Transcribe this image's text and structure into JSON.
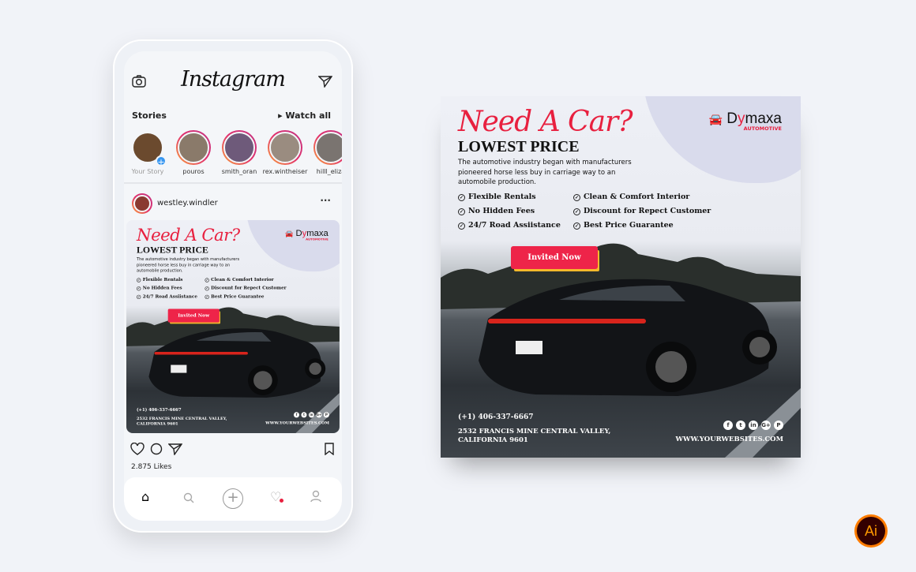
{
  "instagram": {
    "app_title": "Instagram",
    "stories_label": "Stories",
    "watch_all": "Watch all",
    "stories": [
      {
        "name": "Your Story",
        "color": "#6b4a2e"
      },
      {
        "name": "pouros",
        "color": "#8a7a6a"
      },
      {
        "name": "smith_oran",
        "color": "#6e5a7a"
      },
      {
        "name": "rex.wintheiser",
        "color": "#9a8c80"
      },
      {
        "name": "hilll_eliza",
        "color": "#7a7470"
      }
    ],
    "post_user": "westley.windler",
    "likes": "2.875 Likes",
    "icons": [
      "camera-icon",
      "send-icon",
      "heart-icon",
      "comment-icon",
      "share-icon",
      "bookmark-icon",
      "home-icon",
      "search-icon",
      "add-icon",
      "activity-icon",
      "profile-icon"
    ]
  },
  "ad": {
    "headline": "Need A Car?",
    "subheadline": "LOWEST PRICE",
    "description": "The automotive industry began with manufacturers pioneered horse less buy in carriage way to an automobile production.",
    "features": [
      "Flexible Rentals",
      "Clean & Comfort Interior",
      "No Hidden Fees",
      "Discount for Repect Customer",
      "24/7 Road Assiistance",
      "Best Price Guarantee"
    ],
    "cta": "Invited Now",
    "brand_prefix": "D",
    "brand_accent": "y",
    "brand_rest": "maxa",
    "brand_sub": "AUTOMOTIVE",
    "phone": "(+1) 406-337-6667",
    "address": "2532 FRANCIS MINE CENTRAL VALLEY, CALIFORNIA 9601",
    "website": "WWW.YOURWEBSITES.COM",
    "accent": "#ee2449"
  },
  "badge": "Ai"
}
